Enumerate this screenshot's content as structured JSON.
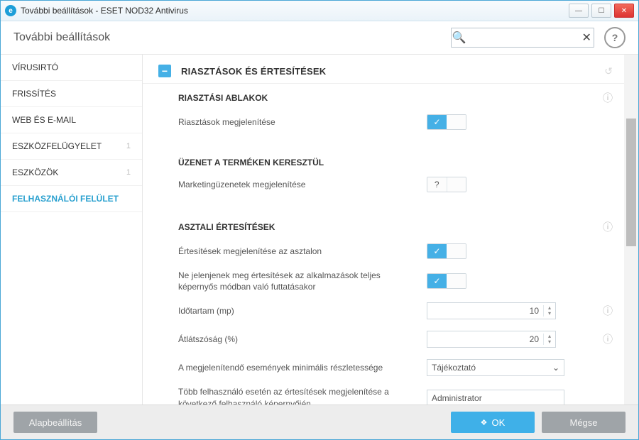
{
  "titlebar": {
    "title": "További beállítások - ESET NOD32 Antivirus",
    "logo_letter": "e"
  },
  "header": {
    "page_title": "További beállítások",
    "search_value": "",
    "help_glyph": "?"
  },
  "sidebar": {
    "items": [
      {
        "label": "VÍRUSIRTÓ",
        "badge": ""
      },
      {
        "label": "FRISSÍTÉS",
        "badge": ""
      },
      {
        "label": "WEB ÉS E-MAIL",
        "badge": ""
      },
      {
        "label": "ESZKÖZFELÜGYELET",
        "badge": "1"
      },
      {
        "label": "ESZKÖZÖK",
        "badge": "1"
      },
      {
        "label": "FELHASZNÁLÓI FELÜLET",
        "badge": ""
      }
    ],
    "active_index": 5
  },
  "section": {
    "title": "RIASZTÁSOK ÉS ÉRTESÍTÉSEK",
    "collapse_glyph": "−",
    "reset_glyph": "↺",
    "groups": [
      {
        "title": "RIASZTÁSI ABLAKOK",
        "rows": [
          {
            "label": "Riasztások megjelenítése",
            "control": "switch_on",
            "check": "✓"
          }
        ]
      },
      {
        "title": "ÜZENET A TERMÉKEN KERESZTÜL",
        "rows": [
          {
            "label": "Marketingüzenetek megjelenítése",
            "control": "switch_q",
            "q": "?"
          }
        ]
      },
      {
        "title": "ASZTALI ÉRTESÍTÉSEK",
        "rows": [
          {
            "label": "Értesítések megjelenítése az asztalon",
            "control": "switch_on",
            "check": "✓"
          },
          {
            "label": "Ne jelenjenek meg értesítések az alkalmazások teljes képernyős módban való futtatásakor",
            "control": "switch_on",
            "check": "✓"
          },
          {
            "label": "Időtartam (mp)",
            "control": "number",
            "value": "10",
            "trail_info": true
          },
          {
            "label": "Átlátszóság (%)",
            "control": "number",
            "value": "20",
            "trail_info": true
          },
          {
            "label": "A megjelenítendő események minimális részletessége",
            "control": "select",
            "value": "Tájékoztató"
          },
          {
            "label": "Több felhasználó esetén az értesítések megjelenítése a következő felhasználó képernyőjén",
            "control": "text",
            "value": "Administrator"
          }
        ]
      }
    ]
  },
  "footer": {
    "default_label": "Alapbeállítás",
    "ok_label": "OK",
    "ok_icon": "❖",
    "cancel_label": "Mégse"
  },
  "icons": {
    "search": "🔍",
    "clear": "✕",
    "info": "ⓘ",
    "chevdown": "⌄",
    "spinup": "▴",
    "spindown": "▾",
    "min": "—",
    "max": "☐",
    "close": "✕"
  }
}
